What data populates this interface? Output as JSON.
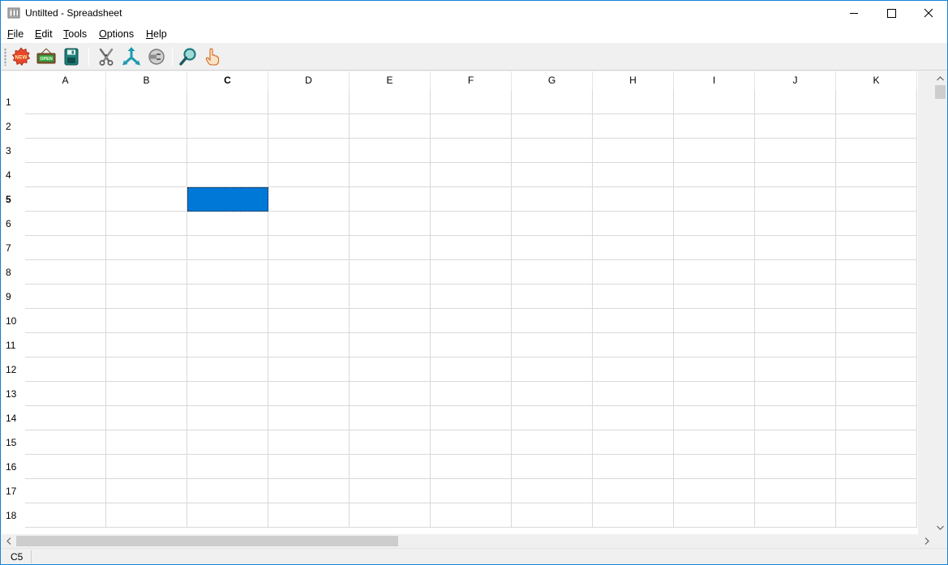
{
  "window": {
    "title": "Untilted - Spreadsheet"
  },
  "menu": [
    {
      "label": "File",
      "accel": "F",
      "rest": "ile"
    },
    {
      "label": "Edit",
      "accel": "E",
      "rest": "dit"
    },
    {
      "label": "Tools",
      "accel": "T",
      "rest": "ools"
    },
    {
      "label": "Options",
      "accel": "O",
      "rest": "ptions"
    },
    {
      "label": "Help",
      "accel": "H",
      "rest": "elp"
    }
  ],
  "toolbar": {
    "buttons": [
      {
        "name": "new-button",
        "icon": "new-icon",
        "badge": "NEW"
      },
      {
        "name": "open-button",
        "icon": "open-icon",
        "badge": "OPEN"
      },
      {
        "name": "save-button",
        "icon": "save-icon"
      },
      {
        "name": "cut-button",
        "icon": "scissors-icon"
      },
      {
        "name": "merge-button",
        "icon": "merge-arrows-icon"
      },
      {
        "name": "connect-button",
        "icon": "plug-icon"
      },
      {
        "name": "find-button",
        "icon": "magnifier-icon"
      },
      {
        "name": "hand-button",
        "icon": "pointing-hand-icon"
      }
    ]
  },
  "grid": {
    "columns": [
      "A",
      "B",
      "C",
      "D",
      "E",
      "F",
      "G",
      "H",
      "I",
      "J",
      "K"
    ],
    "rows": [
      "1",
      "2",
      "3",
      "4",
      "5",
      "6",
      "7",
      "8",
      "9",
      "10",
      "11",
      "12",
      "13",
      "14",
      "15",
      "16",
      "17",
      "18"
    ],
    "active_column": "C",
    "active_row": "5",
    "selection_color": "#0078d7"
  },
  "status": {
    "cell_reference": "C5"
  }
}
